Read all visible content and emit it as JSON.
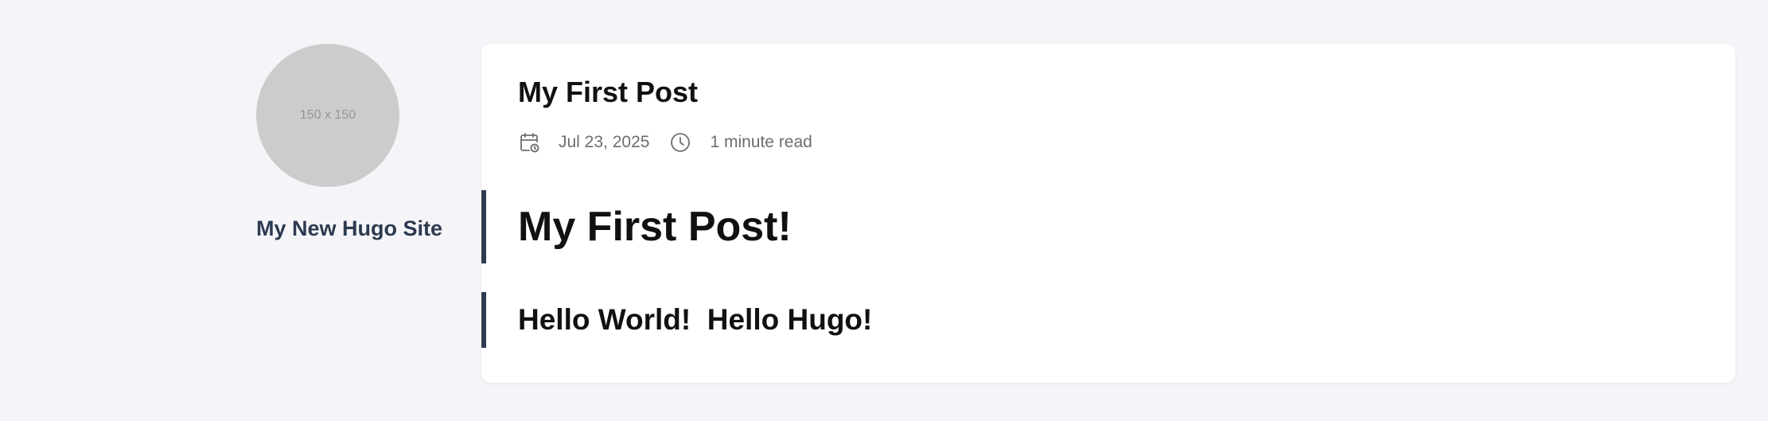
{
  "sidebar": {
    "avatar_text": "150 x 150",
    "site_title": "My New Hugo Site"
  },
  "post": {
    "title": "My First Post",
    "date": "Jul 23, 2025",
    "reading_time": "1 minute read",
    "heading_1": "My First Post!",
    "heading_2": "Hello World!  Hello Hugo!"
  },
  "icons": {
    "date": "calendar-icon",
    "reading_time": "clock-icon"
  },
  "colors": {
    "background": "#f5f5f9",
    "card": "#ffffff",
    "accent": "#2d3a4f",
    "avatar": "#cccccc",
    "meta_text": "#6d6d6d"
  }
}
